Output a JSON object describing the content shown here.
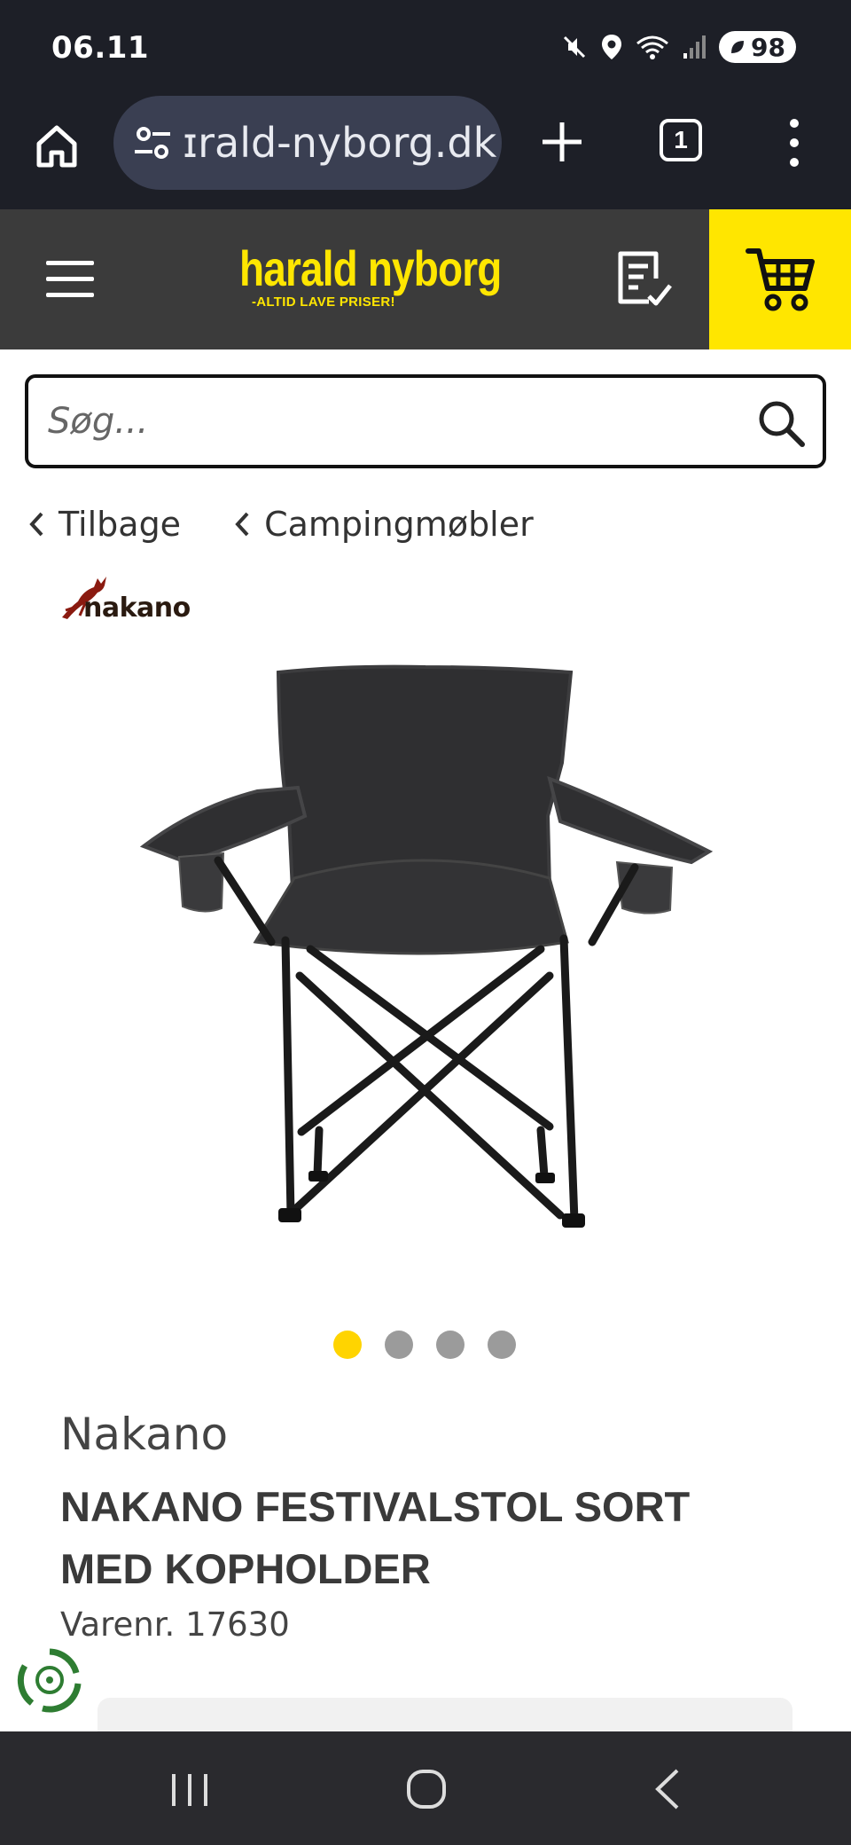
{
  "status_bar": {
    "time": "06.11",
    "battery": "98",
    "icons": [
      "mute-icon",
      "location-icon",
      "wifi-icon",
      "signal-icon",
      "battery-saver-icon"
    ]
  },
  "browser": {
    "url": "ɪrald-nyborg.dk",
    "tab_count": "1",
    "icons": [
      "home-icon",
      "site-settings-icon",
      "new-tab-icon",
      "tab-switcher-icon",
      "more-menu-icon"
    ]
  },
  "site_header": {
    "logo_main": "harald nyborg",
    "logo_tagline": "-ALTID LAVE PRISER!",
    "colors": {
      "header_bg": "#3b3b3b",
      "accent_yellow": "#ffe600"
    }
  },
  "search": {
    "placeholder": "Søg..."
  },
  "breadcrumb": {
    "back_label": "Tilbage",
    "category_label": "Campingmøbler"
  },
  "brand_logo": {
    "text": "nakano"
  },
  "carousel": {
    "total_images": 4,
    "active_index": 0
  },
  "product": {
    "brand": "Nakano",
    "title": "NAKANO FESTIVALSTOL SORT MED KOPHOLDER",
    "sku": "Varenr. 17630"
  },
  "android_nav": {
    "icons": [
      "recents-icon",
      "home-icon",
      "back-icon"
    ]
  }
}
